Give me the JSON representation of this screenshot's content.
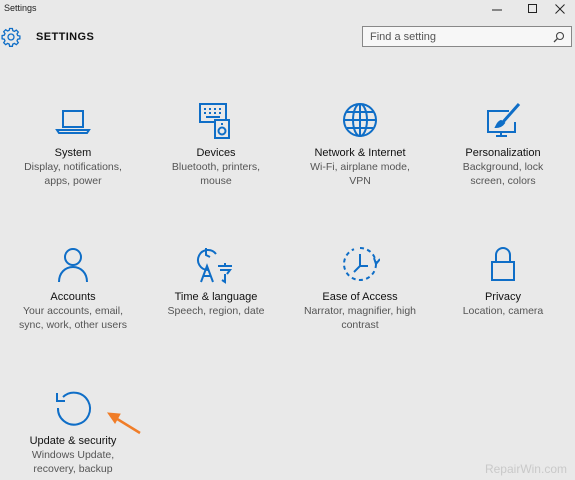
{
  "window": {
    "title": "Settings"
  },
  "header": {
    "heading": "SETTINGS",
    "search_placeholder": "Find a setting"
  },
  "tiles": [
    {
      "name": "System",
      "desc": "Display, notifications, apps, power",
      "icon": "laptop-icon"
    },
    {
      "name": "Devices",
      "desc": "Bluetooth, printers, mouse",
      "icon": "devices-icon"
    },
    {
      "name": "Network & Internet",
      "desc": "Wi-Fi, airplane mode, VPN",
      "icon": "globe-icon"
    },
    {
      "name": "Personalization",
      "desc": "Background, lock screen, colors",
      "icon": "paintbrush-icon"
    },
    {
      "name": "Accounts",
      "desc": "Your accounts, email, sync, work, other users",
      "icon": "person-icon"
    },
    {
      "name": "Time & language",
      "desc": "Speech, region, date",
      "icon": "clock-language-icon"
    },
    {
      "name": "Ease of Access",
      "desc": "Narrator, magnifier, high contrast",
      "icon": "ease-of-access-icon"
    },
    {
      "name": "Privacy",
      "desc": "Location, camera",
      "icon": "lock-icon"
    },
    {
      "name": "Update & security",
      "desc": "Windows Update, recovery, backup",
      "icon": "refresh-icon"
    }
  ],
  "watermark": "RepairWin.com",
  "colors": {
    "accent": "#0f6ec7",
    "annotation_arrow": "#f07d28",
    "background": "#e9e9e9"
  }
}
